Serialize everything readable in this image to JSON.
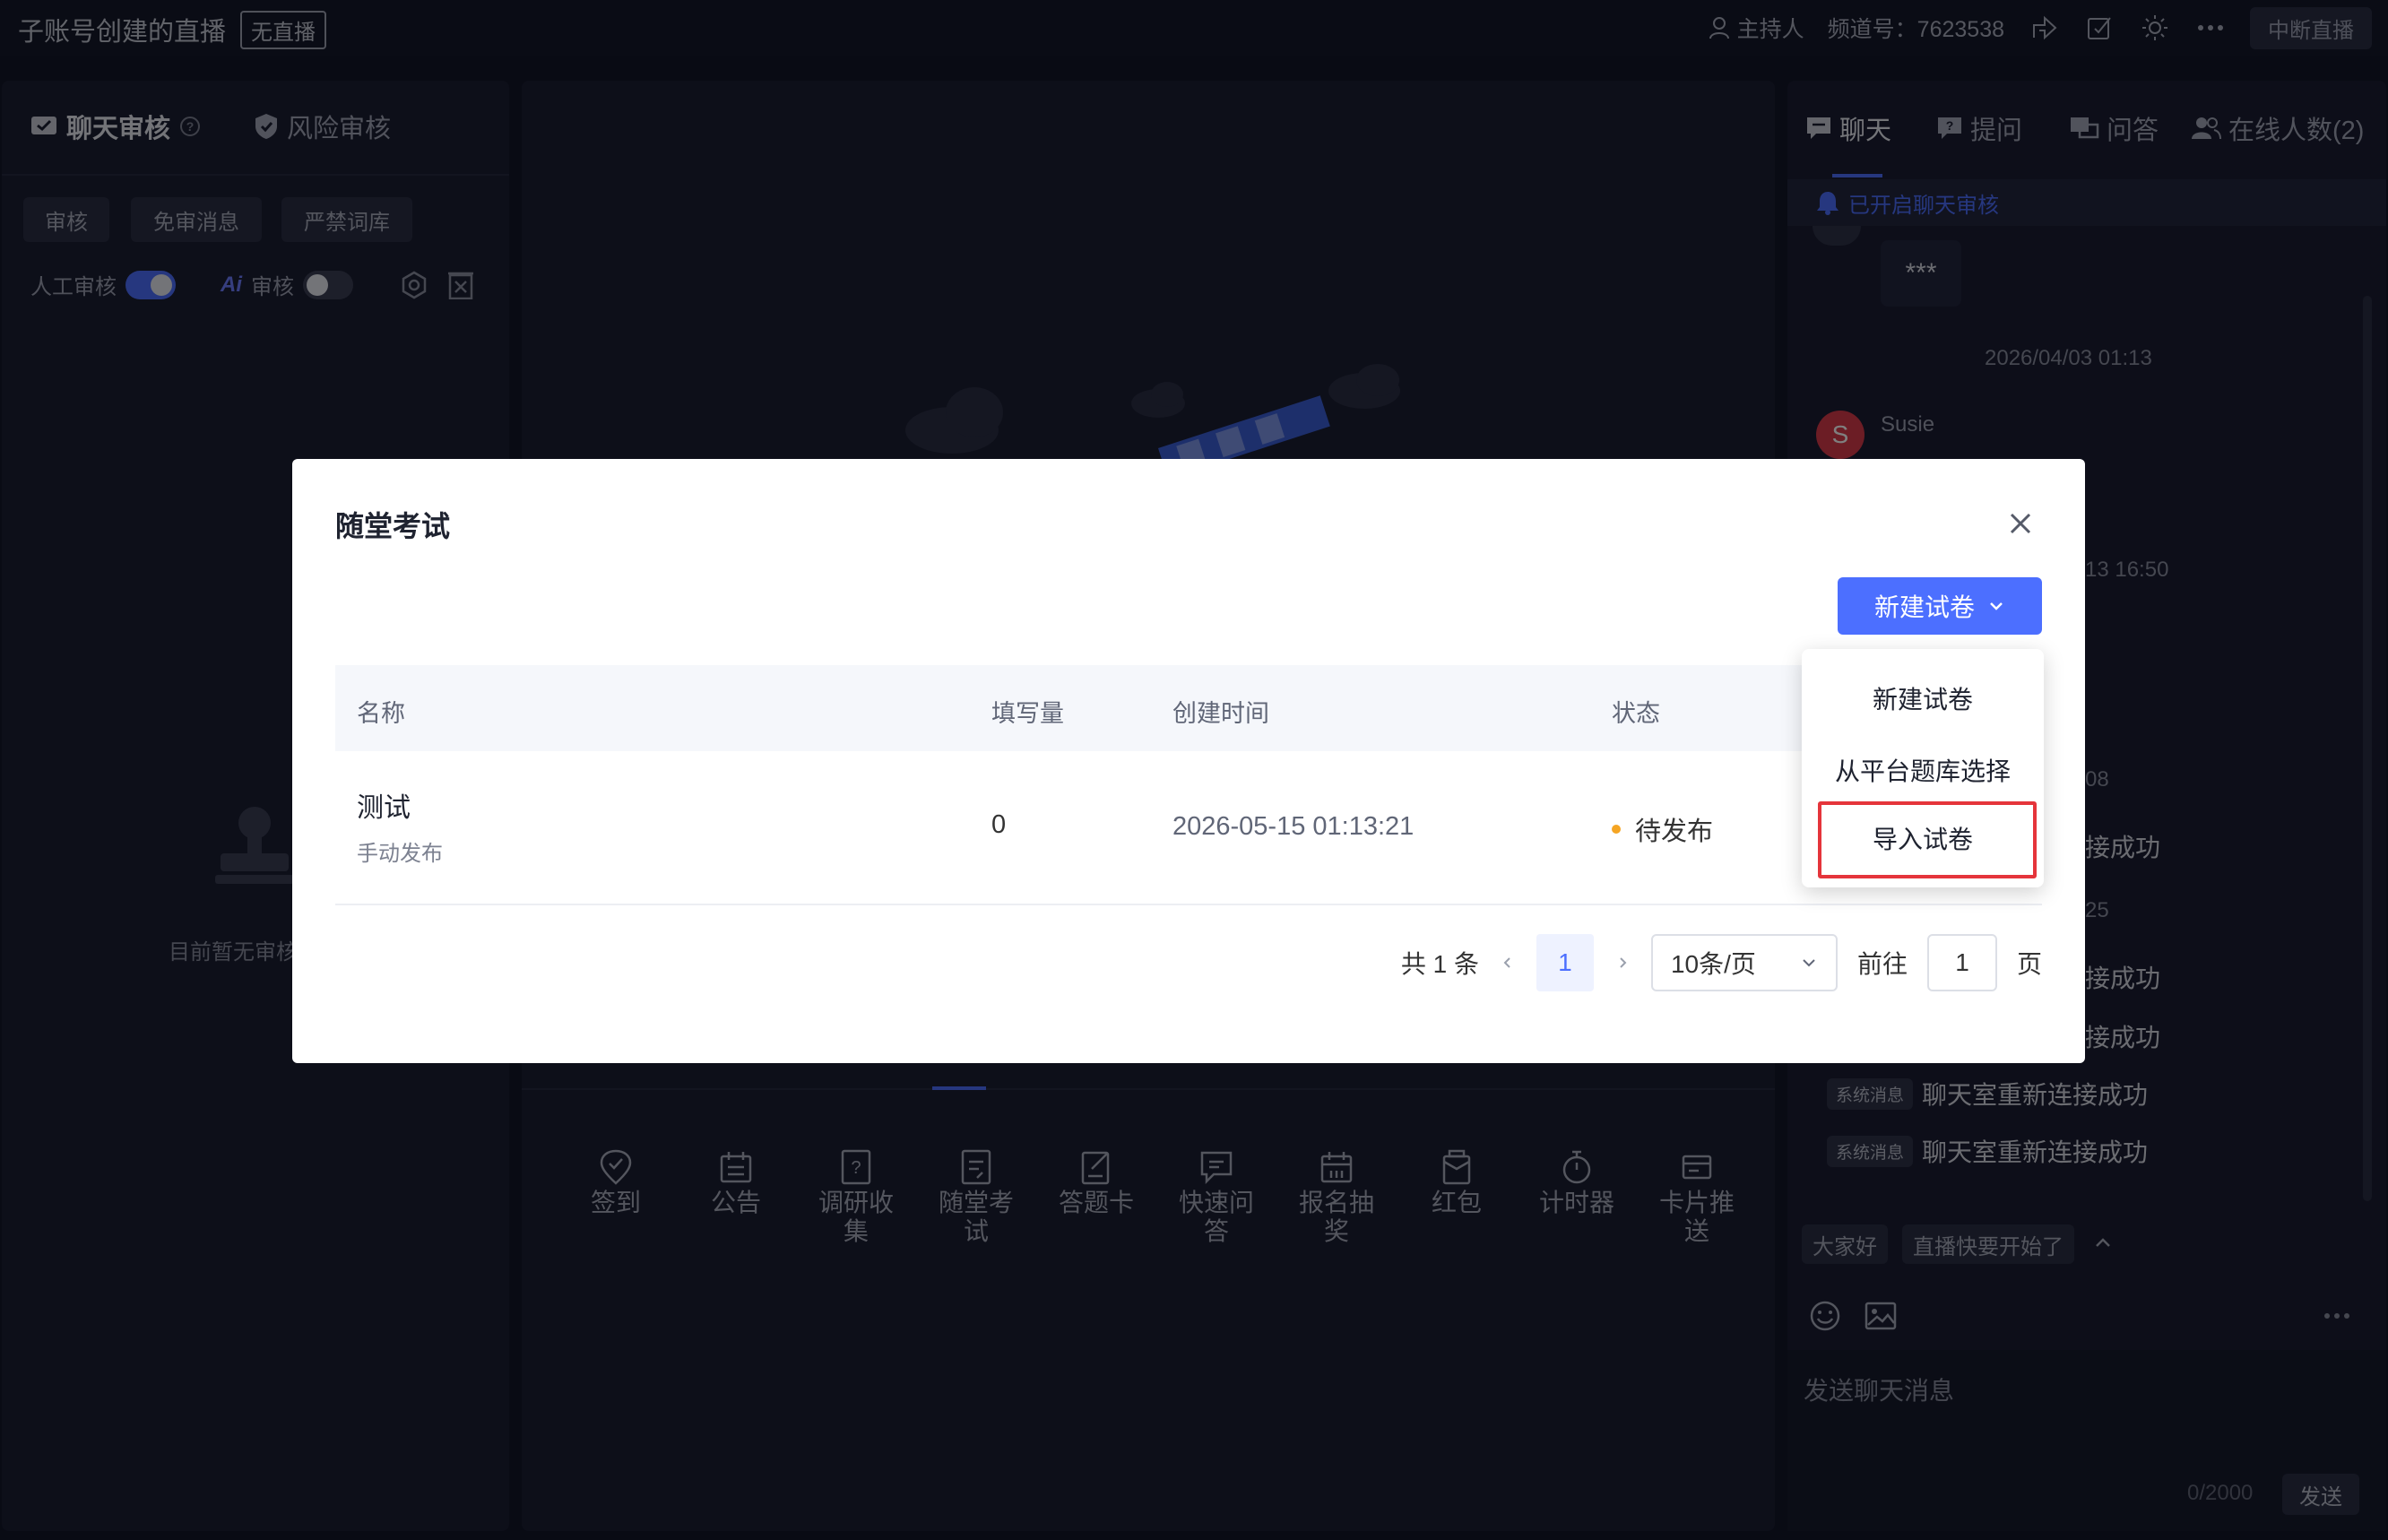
{
  "header": {
    "title": "子账号创建的直播",
    "live_status": "无直播",
    "role": "主持人",
    "channel": "频道号：7623538",
    "stop_button": "中断直播"
  },
  "left_panel": {
    "tabs": [
      "聊天审核",
      "风险审核"
    ],
    "chips": [
      "审核",
      "免审消息",
      "严禁词库"
    ],
    "manual_label": "人工审核",
    "ai_prefix": "Ai",
    "ai_label": "审核",
    "manual_on": true,
    "ai_on": false,
    "empty_text": "目前暂无审核"
  },
  "center": {
    "tools": [
      "签到",
      "公告",
      "调研收\n集",
      "随堂考\n试",
      "答题卡",
      "快速问\n答",
      "报名抽\n奖",
      "红包",
      "计时器",
      "卡片推\n送"
    ]
  },
  "right_panel": {
    "tabs": [
      "聊天",
      "提问",
      "问答",
      "在线人数(2)"
    ],
    "banner": "已开启聊天审核",
    "masked_msg": "***",
    "time1": "2026/04/03 01:13",
    "user_initial": "S",
    "user_name": "Susie",
    "time2_partial": "13 16:50",
    "time3_partial": "08",
    "time4_partial": "25",
    "partial_msgs": [
      "接成功",
      "接成功",
      "接成功"
    ],
    "system_tag": "系统消息",
    "system_msg": "聊天室重新连接成功",
    "quick_replies": [
      "大家好",
      "直播快要开始了"
    ],
    "input_placeholder": "发送聊天消息",
    "char_count": "0/2000",
    "send": "发送"
  },
  "modal": {
    "title": "随堂考试",
    "new_button": "新建试卷",
    "columns": [
      "名称",
      "填写量",
      "创建时间",
      "状态"
    ],
    "rows": [
      {
        "name": "测试",
        "sub": "手动发布",
        "count": "0",
        "created": "2026-05-15 01:13:21",
        "status": "待发布"
      }
    ],
    "pager": {
      "total": "共 1 条",
      "current": "1",
      "page_size": "10条/页",
      "goto_label": "前往",
      "goto_value": "1",
      "page_unit": "页"
    },
    "dropdown": [
      "新建试卷",
      "从平台题库选择",
      "导入试卷"
    ]
  }
}
